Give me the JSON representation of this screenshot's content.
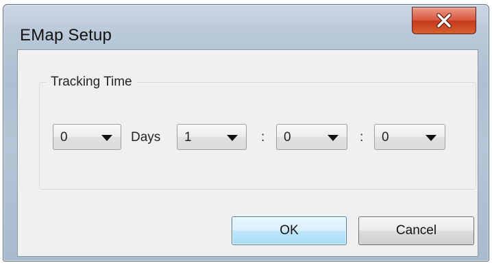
{
  "window": {
    "title": "EMap Setup"
  },
  "group": {
    "label": "Tracking Time"
  },
  "fields": {
    "days": {
      "selected": "0"
    },
    "days_label": "Days",
    "hours": {
      "selected": "1"
    },
    "sep1": ":",
    "minutes": {
      "selected": "0"
    },
    "sep2": ":",
    "seconds": {
      "selected": "0"
    }
  },
  "buttons": {
    "ok": "OK",
    "cancel": "Cancel"
  },
  "icons": {
    "close": "close-icon",
    "dropdown": "chevron-down-icon"
  },
  "colors": {
    "close_button": "#c53a1e",
    "default_button_border": "#3c7fb1",
    "client_bg": "#f0f0f0"
  }
}
